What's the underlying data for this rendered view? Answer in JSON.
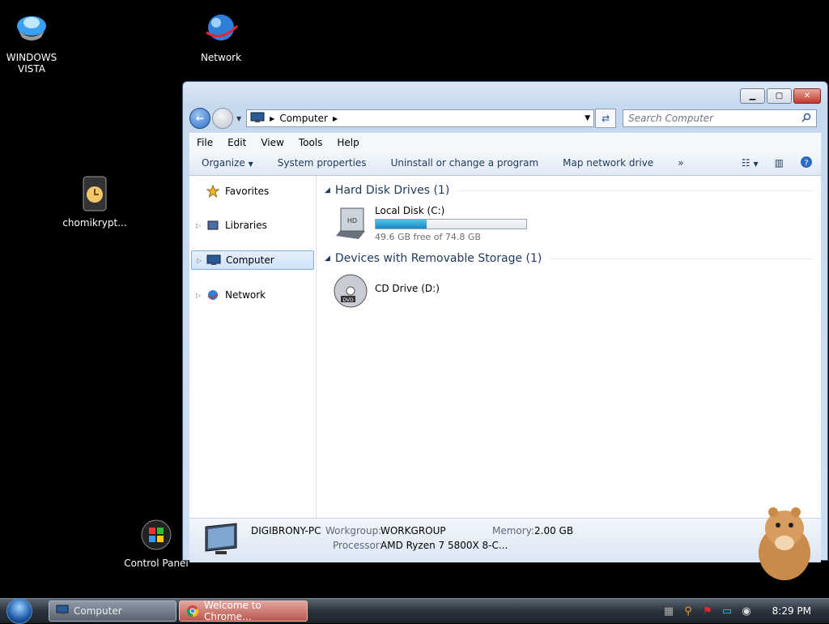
{
  "desktop": {
    "icons": [
      {
        "label": "WINDOWS VISTA"
      },
      {
        "label": "Network"
      },
      {
        "label": "chomikrypt..."
      },
      {
        "label": "Control Panel"
      }
    ]
  },
  "window": {
    "address": {
      "crumb": "Computer"
    },
    "search": {
      "placeholder": "Search Computer"
    },
    "menu": [
      "File",
      "Edit",
      "View",
      "Tools",
      "Help"
    ],
    "commands": [
      "Organize",
      "System properties",
      "Uninstall or change a program",
      "Map network drive"
    ],
    "nav": [
      {
        "label": "Favorites"
      },
      {
        "label": "Libraries"
      },
      {
        "label": "Computer"
      },
      {
        "label": "Network"
      }
    ],
    "groups": [
      {
        "title": "Hard Disk Drives (1)"
      },
      {
        "title": "Devices with Removable Storage (1)"
      }
    ],
    "drives": [
      {
        "name": "Local Disk (C:)",
        "free_text": "49.6 GB free of 74.8 GB",
        "used_fraction": 0.337
      },
      {
        "name": "CD Drive (D:)"
      }
    ],
    "details": {
      "pc_name": "DIGIBRONY-PC",
      "workgroup_label": "Workgroup:",
      "workgroup": "WORKGROUP",
      "memory_label": "Memory:",
      "memory": "2.00 GB",
      "processor_label": "Processor:",
      "processor": "AMD Ryzen 7 5800X 8-C..."
    }
  },
  "taskbar": {
    "tasks": [
      {
        "label": "Computer"
      },
      {
        "label": "Welcome to Chrome..."
      }
    ],
    "clock": "8:29 PM"
  },
  "colors": {
    "accent": "#1e395b",
    "progress": "#1a86c2"
  }
}
